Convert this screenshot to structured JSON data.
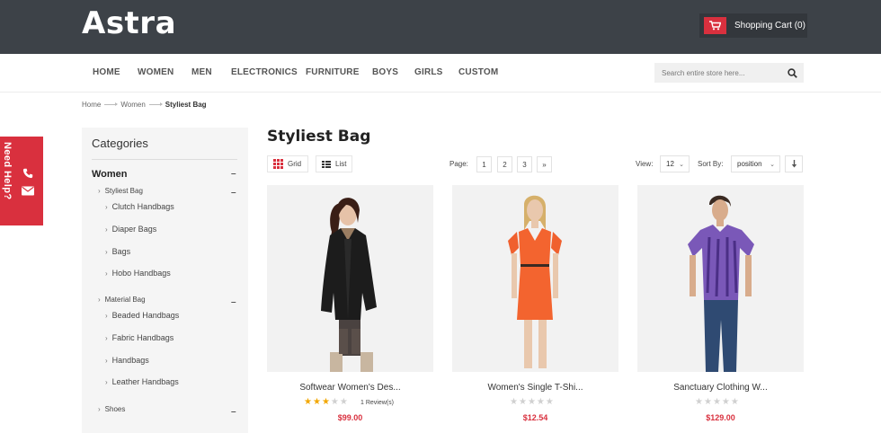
{
  "header": {
    "logo": "Astra",
    "cart_label": "Shopping Cart (0)"
  },
  "nav": {
    "items": [
      "HOME",
      "WOMEN",
      "MEN",
      "ELECTRONICS",
      "FURNITURE",
      "BOYS",
      "GIRLS",
      "CUSTOM"
    ]
  },
  "search": {
    "placeholder": "Search entire store here..."
  },
  "breadcrumb": {
    "items": [
      "Home",
      "Women"
    ],
    "current": "Styliest Bag"
  },
  "help": {
    "label": "Need Help?"
  },
  "sidebar": {
    "title": "Categories",
    "section": "Women",
    "groups": [
      {
        "label": "Styliest Bag",
        "items": [
          "Clutch Handbags",
          "Diaper Bags",
          "Bags",
          "Hobo Handbags"
        ]
      },
      {
        "label": "Material Bag",
        "items": [
          "Beaded Handbags",
          "Fabric Handbags",
          "Handbags",
          "Leather Handbags"
        ]
      },
      {
        "label": "Shoes",
        "items": []
      }
    ]
  },
  "main": {
    "title": "Styliest Bag",
    "view_grid": "Grid",
    "view_list": "List",
    "page_label": "Page:",
    "pages": [
      "1",
      "2",
      "3",
      "»"
    ],
    "view_label": "View:",
    "view_value": "12",
    "sort_label": "Sort By:",
    "sort_value": "position"
  },
  "products": [
    {
      "name": "Softwear Women's Des...",
      "rating": 3,
      "reviews": "1 Review(s)",
      "price": "$99.00"
    },
    {
      "name": "Women's Single T-Shi...",
      "rating": 0,
      "reviews": "",
      "price": "$12.54"
    },
    {
      "name": "Sanctuary Clothing W...",
      "rating": 0,
      "reviews": "",
      "price": "$129.00"
    }
  ],
  "colors": {
    "accent": "#d9303e",
    "header_bg": "#3d4248",
    "star": "#f2a700"
  }
}
